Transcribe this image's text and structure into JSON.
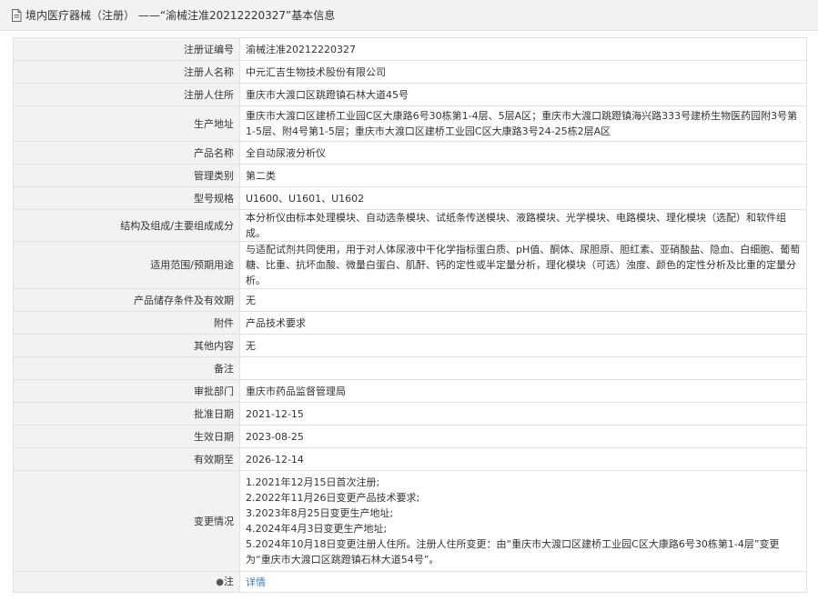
{
  "header": {
    "title": "境内医疗器械（注册） ——“渝械注准20212220327”基本信息"
  },
  "rows": [
    {
      "label": "注册证编号",
      "value": "渝械注准20212220327"
    },
    {
      "label": "注册人名称",
      "value": "中元汇吉生物技术股份有限公司"
    },
    {
      "label": "注册人住所",
      "value": "重庆市大渡口区跳蹬镇石林大道45号"
    },
    {
      "label": "生产地址",
      "value": "重庆市大渡口区建桥工业园C区大康路6号30栋第1-4层、5层A区；重庆市大渡口跳蹬镇海兴路333号建桥生物医药园附3号第1-5层、附4号第1-5层；重庆市大渡口区建桥工业园C区大康路3号24-25栋2层A区"
    },
    {
      "label": "产品名称",
      "value": "全自动尿液分析仪"
    },
    {
      "label": "管理类别",
      "value": "第二类"
    },
    {
      "label": "型号规格",
      "value": "U1600、U1601、U1602"
    },
    {
      "label": "结构及组成/主要组成成分",
      "value": "本分析仪由标本处理模块、自动选条模块、试纸条传送模块、液路模块、光学模块、电路模块、理化模块（选配）和软件组成。"
    },
    {
      "label": "适用范围/预期用途",
      "value": "与适配试剂共同使用，用于对人体尿液中干化学指标蛋白质、pH值、酮体、尿胆原、胆红素、亚硝酸盐、隐血、白细胞、葡萄糖、比重、抗坏血酸、微量白蛋白、肌酐、钙的定性或半定量分析，理化模块（可选）浊度、颜色的定性分析及比重的定量分析。"
    },
    {
      "label": "产品储存条件及有效期",
      "value": "无"
    },
    {
      "label": "附件",
      "value": "产品技术要求"
    },
    {
      "label": "其他内容",
      "value": "无"
    },
    {
      "label": "备注",
      "value": ""
    },
    {
      "label": "审批部门",
      "value": "重庆市药品监督管理局"
    },
    {
      "label": "批准日期",
      "value": "2021-12-15"
    },
    {
      "label": "生效日期",
      "value": "2023-08-25"
    },
    {
      "label": "有效期至",
      "value": "2026-12-14"
    }
  ],
  "changes": {
    "label": "变更情况",
    "lines": [
      "1.2021年12月15日首次注册;",
      "2.2022年11月26日变更产品技术要求;",
      "3.2023年8月25日变更生产地址;",
      "4.2024年4月3日变更生产地址;",
      "5.2024年10月18日变更注册人住所。注册人住所变更：由“重庆市大渡口区建桥工业园C区大康路6号30栋第1-4层”变更为“重庆市大渡口区跳蹬镇石林大道54号”。"
    ]
  },
  "note": {
    "pin_glyph": "●",
    "label": "注",
    "link": "详情"
  }
}
